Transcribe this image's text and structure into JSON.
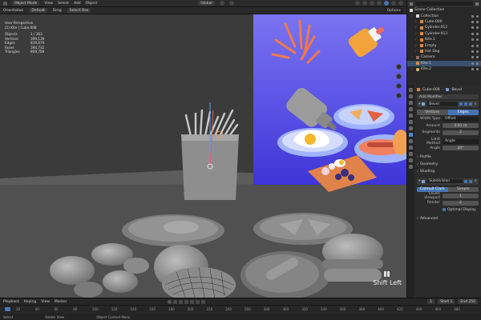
{
  "header": {
    "mode": "Object Mode",
    "menus": [
      "View",
      "Select",
      "Add",
      "Object"
    ],
    "transform_orientation": "Global",
    "right_button": "Options"
  },
  "toolbar": {
    "orientation_label": "Orientation",
    "orientation_value": "Default",
    "drag_label": "Drag",
    "drag_value": "Select Box"
  },
  "viewport": {
    "view_name": "User Perspective",
    "object_line": "(1) Kite | Cube.008",
    "stats": [
      {
        "label": "Objects",
        "value": "1 / 363"
      },
      {
        "label": "Vertices",
        "value": "399,139"
      },
      {
        "label": "Edges",
        "value": "839,679"
      },
      {
        "label": "Faces",
        "value": "394,732"
      },
      {
        "label": "Triangles",
        "value": "809,789"
      }
    ],
    "keystroke": "Shift Left"
  },
  "outliner": {
    "title": "Scene Collection",
    "items": [
      {
        "label": "Collection",
        "icon": "collection",
        "indent": 0,
        "selected": false
      },
      {
        "label": "Cube.000",
        "icon": "mesh",
        "indent": 1,
        "selected": false
      },
      {
        "label": "Cylinder.012",
        "icon": "mesh",
        "indent": 1,
        "selected": false
      },
      {
        "label": "Cylinder.013",
        "icon": "mesh",
        "indent": 1,
        "selected": false
      },
      {
        "label": "Kite.1",
        "icon": "mesh",
        "indent": 1,
        "selected": false
      },
      {
        "label": "Empty",
        "icon": "mesh",
        "indent": 1,
        "selected": false
      },
      {
        "label": "Hot Dog",
        "icon": "mesh",
        "indent": 1,
        "selected": false
      },
      {
        "label": "Camera",
        "icon": "camera",
        "indent": 0,
        "selected": false
      },
      {
        "label": "Kite.1",
        "icon": "mesh",
        "indent": 0,
        "selected": true
      },
      {
        "label": "Kite.2",
        "icon": "light",
        "indent": 0,
        "selected": false
      }
    ]
  },
  "properties": {
    "object_name": "Cube.008",
    "modifier_type": "Bevel",
    "add_modifier": "Add Modifier",
    "bevel": {
      "name": "Bevel",
      "mode_tabs": [
        "Vertices",
        "Edges"
      ],
      "active_mode": "Edges",
      "rows": [
        {
          "label": "Width Type",
          "value": "Offset",
          "dark": true
        },
        {
          "label": "Amount",
          "value": "0.01 m",
          "dark": false
        },
        {
          "label": "Segments",
          "value": "2",
          "dark": false
        }
      ],
      "limit_method_label": "Limit Method",
      "limit_method_value": "Angle",
      "angle_label": "Angle",
      "angle_value": "30°",
      "sections": [
        "Profile",
        "Geometry",
        "Shading"
      ]
    },
    "subsurf": {
      "name": "Subdivision",
      "tabs": [
        "Catmull-Clark",
        "Simple"
      ],
      "active_tab": "Catmull-Clark",
      "levels_label": "Levels Viewport",
      "levels_value": "1",
      "render_label": "Render",
      "render_value": "2",
      "optimal_label": "Optimal Display",
      "advanced": "Advanced"
    }
  },
  "timeline": {
    "menus": [
      "Playback",
      "Keying",
      "View",
      "Marker"
    ],
    "current_frame": "1",
    "start_label": "Start",
    "start_value": "1",
    "end_label": "End",
    "end_value": "250",
    "ruler": [
      "20",
      "40",
      "60",
      "80",
      "100",
      "120",
      "140",
      "160",
      "180",
      "200",
      "220",
      "240",
      "260",
      "280",
      "300",
      "320",
      "340",
      "360",
      "380",
      "400",
      "420",
      "440",
      "460",
      "480"
    ]
  },
  "statusbar": {
    "items": [
      "Select",
      "Rotate View",
      "Object Context Menu"
    ]
  },
  "colors": {
    "accent": "#4774b3",
    "selection": "#37516e",
    "viewport_bg": "#3a3a3a",
    "render_bg": "#5b52e0"
  }
}
